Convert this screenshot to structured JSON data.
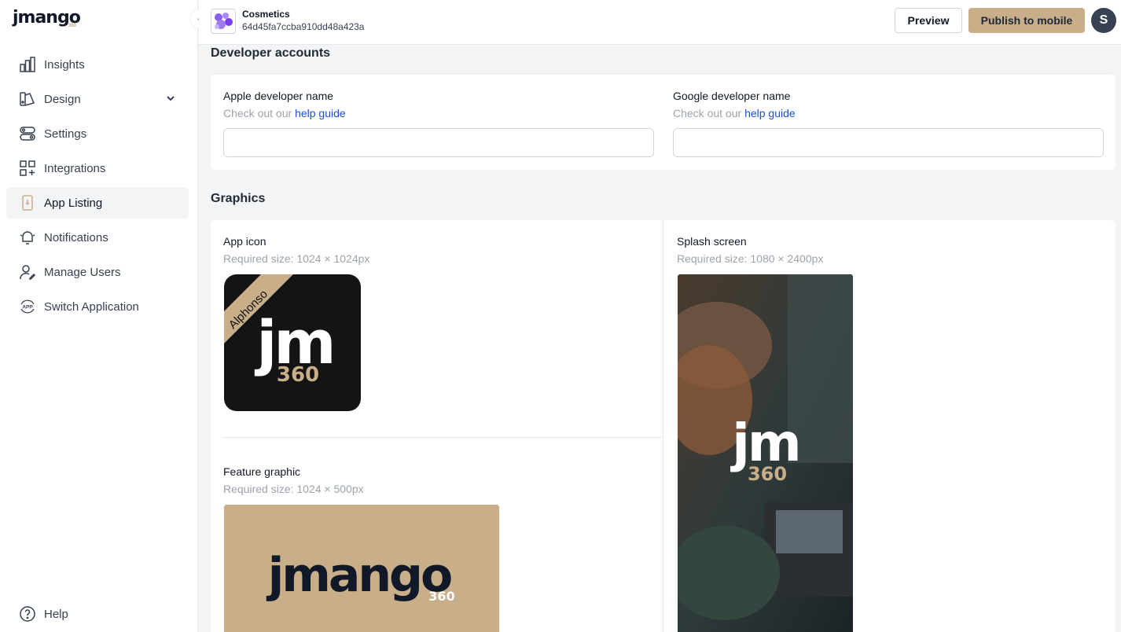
{
  "brand": {
    "logo_text": "jmango",
    "logo_sub": "360",
    "accent": "#c8ae89"
  },
  "sidebar": {
    "items": [
      {
        "label": "Insights",
        "icon": "bar-chart-icon"
      },
      {
        "label": "Design",
        "icon": "palette-icon",
        "expandable": true
      },
      {
        "label": "Settings",
        "icon": "toggles-icon"
      },
      {
        "label": "Integrations",
        "icon": "integrations-icon"
      },
      {
        "label": "App Listing",
        "icon": "phone-icon",
        "active": true
      },
      {
        "label": "Notifications",
        "icon": "bell-icon"
      },
      {
        "label": "Manage Users",
        "icon": "user-edit-icon"
      },
      {
        "label": "Switch Application",
        "icon": "app-switch-icon"
      }
    ],
    "help_label": "Help"
  },
  "header": {
    "app_name": "Cosmetics",
    "app_id": "64d45fa7ccba910dd48a423a",
    "preview_label": "Preview",
    "publish_label": "Publish to mobile",
    "avatar_initial": "S"
  },
  "developer_accounts": {
    "title": "Developer accounts",
    "apple": {
      "label": "Apple developer name",
      "help_prefix": "Check out our",
      "help_link": "help guide",
      "value": ""
    },
    "google": {
      "label": "Google developer name",
      "help_prefix": "Check out our",
      "help_link": "help guide",
      "value": ""
    }
  },
  "graphics": {
    "title": "Graphics",
    "app_icon": {
      "label": "App icon",
      "size": "Required size: 1024 × 1024px",
      "ribbon": "Alphonso",
      "mark": "jm",
      "sub": "360"
    },
    "splash": {
      "label": "Splash screen",
      "size": "Required size: 1080 × 2400px",
      "mark": "jm",
      "sub": "360"
    },
    "feature": {
      "label": "Feature graphic",
      "size": "Required size: 1024 × 500px",
      "mark": "jmango",
      "sub": "360"
    }
  }
}
